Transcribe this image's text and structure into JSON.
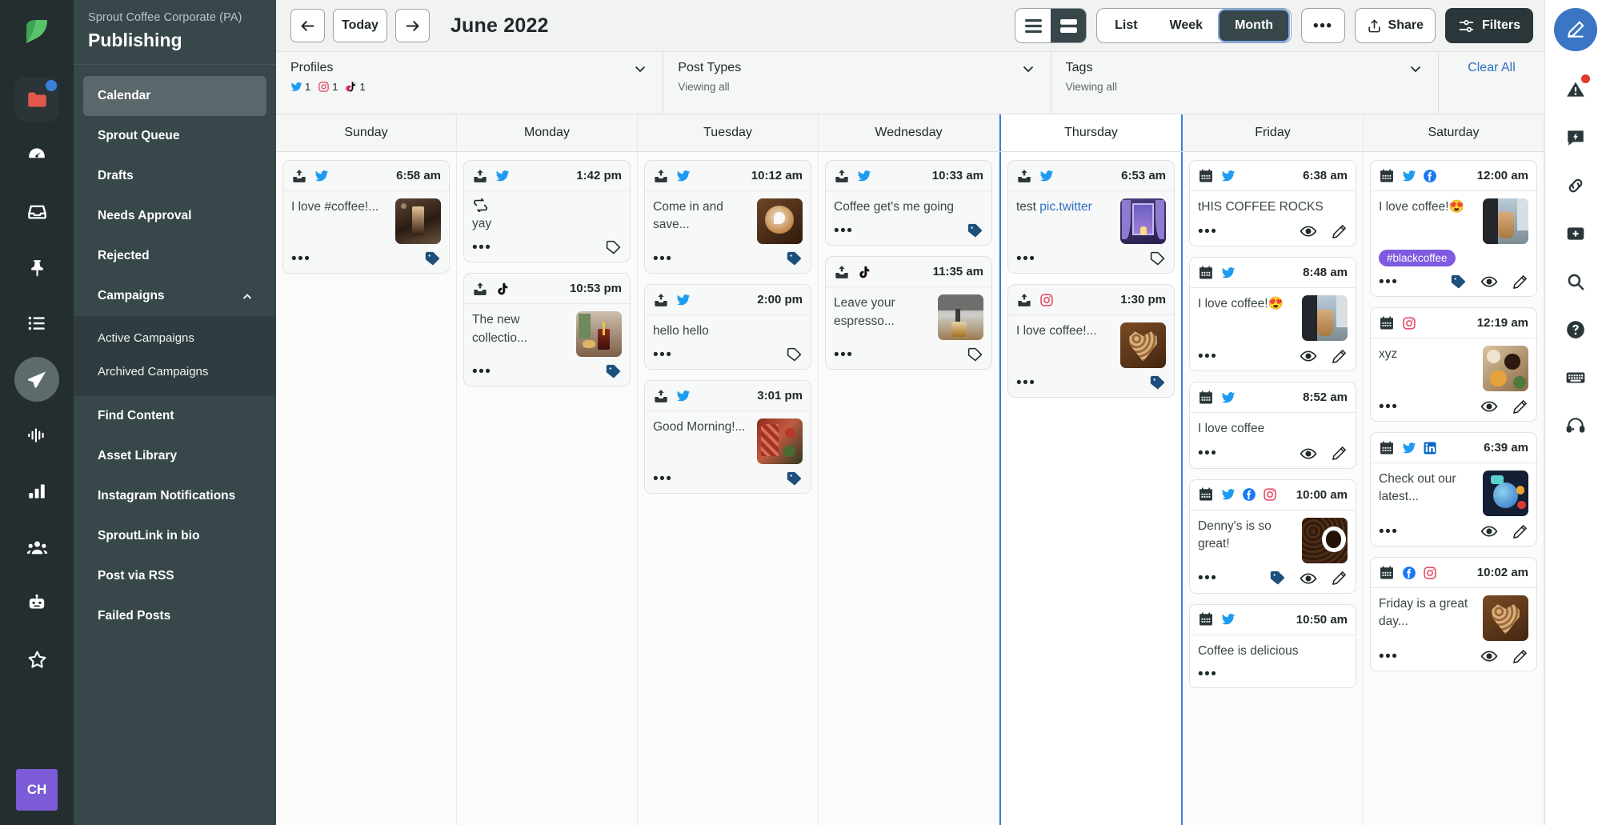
{
  "rail": {
    "logo": "sprout-leaf-logo",
    "items": [
      {
        "icon": "folder-icon",
        "badge": true,
        "boxed": true
      },
      {
        "icon": "dashboard-gauge-icon"
      },
      {
        "icon": "inbox-icon"
      },
      {
        "icon": "pin-icon"
      },
      {
        "icon": "list-icon"
      },
      {
        "icon": "publish-paperplane-icon",
        "active": true
      },
      {
        "icon": "listening-waveform-icon"
      },
      {
        "icon": "reports-bars-icon"
      },
      {
        "icon": "audience-people-icon"
      },
      {
        "icon": "bot-icon"
      },
      {
        "icon": "star-icon"
      }
    ],
    "avatar_initials": "CH"
  },
  "nav": {
    "org": "Sprout Coffee Corporate (PA)",
    "title": "Publishing",
    "items": [
      {
        "label": "Calendar",
        "selected": true
      },
      {
        "label": "Sprout Queue"
      },
      {
        "label": "Drafts"
      },
      {
        "label": "Needs Approval"
      },
      {
        "label": "Rejected"
      },
      {
        "label": "Campaigns",
        "expandable": true,
        "expanded": true
      },
      {
        "label": "Find Content"
      },
      {
        "label": "Asset Library"
      },
      {
        "label": "Instagram Notifications"
      },
      {
        "label": "SproutLink in bio"
      },
      {
        "label": "Post via RSS"
      },
      {
        "label": "Failed Posts"
      }
    ],
    "campaign_children": [
      {
        "label": "Active Campaigns"
      },
      {
        "label": "Archived Campaigns"
      }
    ]
  },
  "toolbar": {
    "prev_label": "←",
    "today_label": "Today",
    "next_label": "→",
    "month_title": "June 2022",
    "density": [
      {
        "name": "compact-density",
        "selected": false
      },
      {
        "name": "comfortable-density",
        "selected": true
      }
    ],
    "views": [
      {
        "label": "List",
        "selected": false
      },
      {
        "label": "Week",
        "selected": false
      },
      {
        "label": "Month",
        "selected": true
      }
    ],
    "more_label": "•••",
    "share_label": "Share",
    "filters_label": "Filters"
  },
  "filters": {
    "profiles": {
      "label": "Profiles",
      "counts": [
        {
          "network": "twitter",
          "count": "1"
        },
        {
          "network": "instagram",
          "count": "1"
        },
        {
          "network": "tiktok",
          "count": "1"
        }
      ]
    },
    "post_types": {
      "label": "Post Types",
      "value": "Viewing all"
    },
    "tags": {
      "label": "Tags",
      "value": "Viewing all"
    },
    "clear_all": "Clear All"
  },
  "calendar": {
    "days": [
      {
        "name": "Sunday",
        "today": false,
        "posts": [
          {
            "status": "scheduled",
            "networks": [
              "twitter"
            ],
            "time": "6:58 am",
            "text": "I love #coffee!...",
            "thumb": "coldbrew",
            "tag_filled": true,
            "actions": []
          }
        ]
      },
      {
        "name": "Monday",
        "today": false,
        "posts": [
          {
            "status": "scheduled",
            "networks": [
              "twitter"
            ],
            "time": "1:42 pm",
            "retweet": true,
            "text": "yay",
            "thumb": null,
            "tag_filled": false,
            "actions": []
          },
          {
            "status": "scheduled",
            "networks": [
              "tiktok"
            ],
            "time": "10:53 pm",
            "text": "The new collectio...",
            "thumb": "cafe-table",
            "tag_filled": true,
            "actions": []
          }
        ]
      },
      {
        "name": "Tuesday",
        "today": false,
        "posts": [
          {
            "status": "scheduled",
            "networks": [
              "twitter"
            ],
            "time": "10:12 am",
            "text": "Come in and save...",
            "thumb": "latte-art",
            "tag_filled": true,
            "actions": []
          },
          {
            "status": "scheduled",
            "networks": [
              "twitter"
            ],
            "time": "2:00 pm",
            "text": "hello hello",
            "thumb": null,
            "tag_filled": false,
            "actions": []
          },
          {
            "status": "scheduled",
            "networks": [
              "twitter"
            ],
            "time": "3:01 pm",
            "text": "Good Morning!...",
            "thumb": "rug-apples",
            "tag_filled": true,
            "actions": []
          }
        ]
      },
      {
        "name": "Wednesday",
        "today": false,
        "posts": [
          {
            "status": "scheduled",
            "networks": [
              "twitter"
            ],
            "time": "10:33 am",
            "text": "Coffee get's me going",
            "thumb": null,
            "tag_filled": true,
            "actions": []
          },
          {
            "status": "scheduled",
            "networks": [
              "tiktok"
            ],
            "time": "11:35 am",
            "text": "Leave your espresso...",
            "thumb": "espresso-machine",
            "tag_filled": false,
            "actions": []
          }
        ]
      },
      {
        "name": "Thursday",
        "today": true,
        "posts": [
          {
            "status": "scheduled",
            "networks": [
              "twitter"
            ],
            "time": "6:53 am",
            "text": "test ",
            "link_text": "pic.twitter",
            "thumb": "window-night",
            "tag_filled": false,
            "actions": []
          },
          {
            "status": "scheduled",
            "networks": [
              "instagram"
            ],
            "time": "1:30 pm",
            "text": "I love coffee!...",
            "thumb": "coffee-heart",
            "tag_filled": true,
            "actions": []
          }
        ]
      },
      {
        "name": "Friday",
        "today": false,
        "posts": [
          {
            "status": "published",
            "networks": [
              "twitter"
            ],
            "time": "6:38 am",
            "text": "tHIS COFFEE ROCKS",
            "thumb": null,
            "tag_filled": null,
            "actions": [
              "eye",
              "pencil"
            ]
          },
          {
            "status": "published",
            "networks": [
              "twitter"
            ],
            "time": "8:48 am",
            "text": "I love coffee!😍",
            "thumb": "iced-coffee-street",
            "tag_filled": null,
            "actions": [
              "eye",
              "pencil"
            ]
          },
          {
            "status": "published",
            "networks": [
              "twitter"
            ],
            "time": "8:52 am",
            "text": "I love coffee",
            "thumb": null,
            "tag_filled": null,
            "actions": [
              "eye",
              "pencil"
            ]
          },
          {
            "status": "published",
            "networks": [
              "twitter",
              "facebook",
              "instagram"
            ],
            "time": "10:00 am",
            "text": "Denny's is so great!",
            "thumb": "coffee-beans-cup",
            "tag_filled": true,
            "actions": [
              "eye",
              "pencil"
            ]
          },
          {
            "status": "published",
            "networks": [
              "twitter"
            ],
            "time": "10:50 am",
            "text": "Coffee is delicious",
            "thumb": null,
            "tag_filled": null,
            "actions": []
          }
        ]
      },
      {
        "name": "Saturday",
        "today": false,
        "posts": [
          {
            "status": "published",
            "networks": [
              "twitter",
              "facebook"
            ],
            "time": "12:00 am",
            "text": "I love coffee!😍",
            "thumb": "iced-coffee-street",
            "pill": "#blackcoffee",
            "tag_filled": true,
            "actions": [
              "eye",
              "pencil"
            ]
          },
          {
            "status": "published",
            "networks": [
              "instagram"
            ],
            "time": "12:19 am",
            "text": "xyz",
            "thumb": "flatlay-brunch",
            "tag_filled": null,
            "actions": [
              "eye",
              "pencil"
            ]
          },
          {
            "status": "published",
            "networks": [
              "twitter",
              "linkedin"
            ],
            "time": "6:39 am",
            "text": "Check out our latest...",
            "thumb": "crystal-ball",
            "tag_filled": null,
            "actions": [
              "eye",
              "pencil"
            ]
          },
          {
            "status": "published",
            "networks": [
              "facebook",
              "instagram"
            ],
            "time": "10:02 am",
            "text": "Friday is a great day...",
            "thumb": "coffee-heart",
            "tag_filled": null,
            "actions": [
              "eye",
              "pencil"
            ]
          }
        ]
      }
    ]
  },
  "rightrail": {
    "compose": "compose-icon",
    "items": [
      {
        "icon": "alert-warning-icon",
        "badge": true
      },
      {
        "icon": "feedback-bolt-icon",
        "badge": false
      },
      {
        "icon": "link-chain-icon",
        "badge": false
      },
      {
        "icon": "add-plus-icon",
        "badge": false
      },
      {
        "icon": "search-icon",
        "badge": false
      },
      {
        "icon": "help-question-icon",
        "badge": false
      },
      {
        "icon": "keyboard-icon",
        "badge": false
      },
      {
        "icon": "support-headset-icon",
        "badge": false
      }
    ]
  },
  "colors": {
    "accent_blue": "#3b7fdc",
    "dark": "#37474a",
    "rail_dark": "#242e30",
    "purple_tag": "#7f5ae0",
    "link": "#2f6fc4"
  }
}
